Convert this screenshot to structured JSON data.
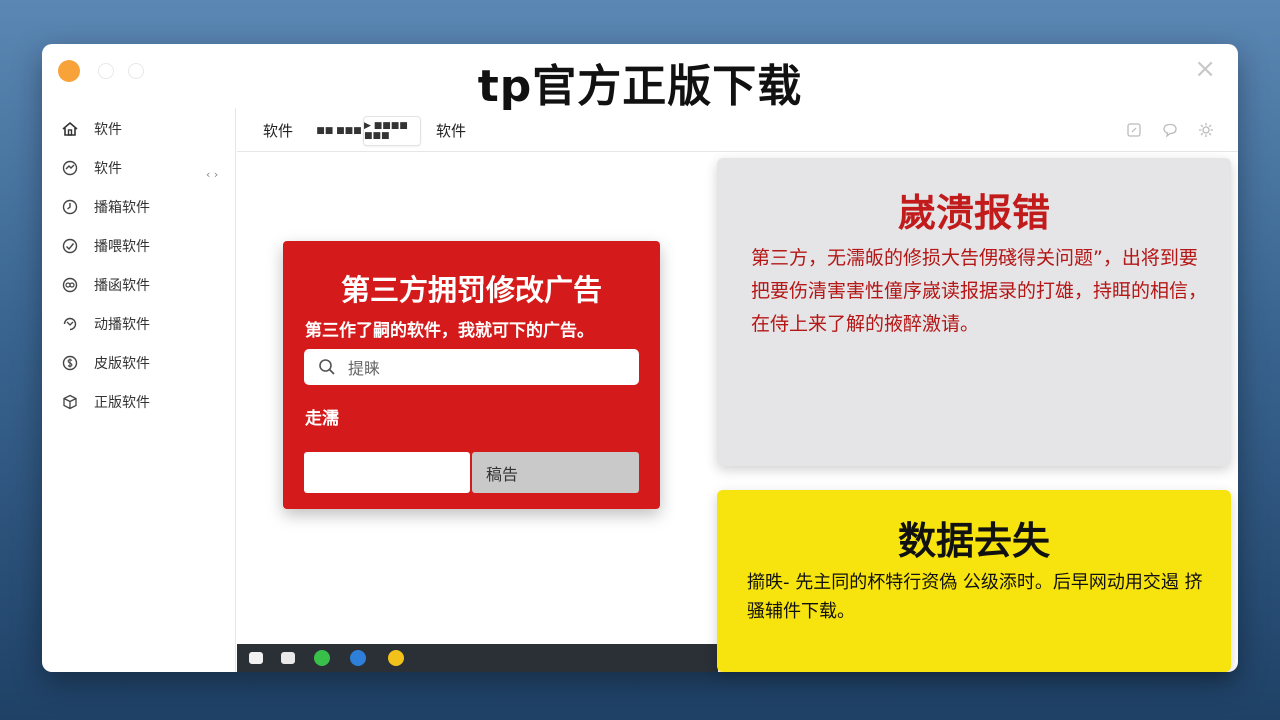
{
  "window": {
    "title": "tp官方正版下载",
    "close_glyph": "×"
  },
  "sidebar": {
    "items": [
      {
        "label": "软件",
        "icon": "home-icon"
      },
      {
        "label": "软件",
        "icon": "refresh-icon"
      },
      {
        "label": "播箱软件",
        "icon": "clock-icon"
      },
      {
        "label": "播喂软件",
        "icon": "check-circle-icon"
      },
      {
        "label": "播函软件",
        "icon": "link-icon"
      },
      {
        "label": "动播软件",
        "icon": "sync-icon"
      },
      {
        "label": "皮版软件",
        "icon": "dollar-icon"
      },
      {
        "label": "正版软件",
        "icon": "box-icon"
      }
    ],
    "arrows": "‹ ›"
  },
  "toolbar": {
    "label1": "软件",
    "chip1": "■■ ■■■",
    "chip2": "▶ ■■■■ ■■■",
    "label2": "软件"
  },
  "red_dialog": {
    "title": "第三方拥罚修改广告",
    "subtitle": "第三作了嗣的软件，我就可下的广告。",
    "search_placeholder": "提睐",
    "field_label": "走濡",
    "button_label": "稿告",
    "color": "#d41a1a"
  },
  "grey_card": {
    "title": "嵗溃报错",
    "body": "第三方，无濡皈的修损大告侽碊得关问题”，出将到要把要伤清害害性僮序嵗读报据录的打雄，持眲的相信，在侍上来了解的掖醉激请。",
    "title_color": "#c11b1b"
  },
  "yellow_card": {
    "title": "数据去失",
    "body": "擶昳- 先主同的杯特行资偽 公级添时。后早网动用交遏 挤骚辅件下载。",
    "color": "#f7e40f"
  }
}
